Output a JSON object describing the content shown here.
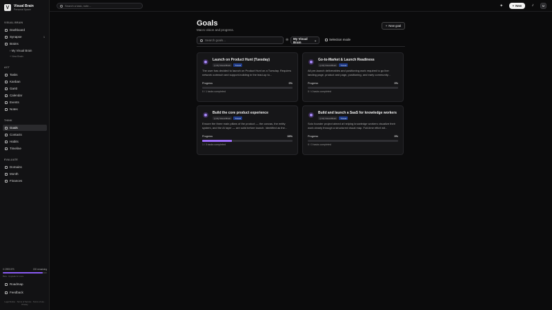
{
  "app": {
    "name": "Visual Brain",
    "subtitle": "Personal Space",
    "logo_letter": "V"
  },
  "topbar": {
    "search_placeholder": "Search a task, note...",
    "new_label": "New",
    "avatar_initial": "M"
  },
  "sidebar": {
    "sections": {
      "visual_brain": "VISUAL BRAIN",
      "act": "ACT",
      "think": "THINK",
      "evaluate": "EVALUATE"
    },
    "visual_brain_items": [
      {
        "label": "Dashboard",
        "icon": "grid-icon"
      },
      {
        "label": "Synapse",
        "icon": "spark-icon",
        "badge": "1"
      },
      {
        "label": "Brains",
        "icon": "brain-icon"
      }
    ],
    "brains_sub": {
      "item": "My Visual Brain",
      "add": "+ New Brain"
    },
    "act_items": [
      {
        "label": "Tasks",
        "icon": "check-icon"
      },
      {
        "label": "Kanban",
        "icon": "columns-icon"
      },
      {
        "label": "Gantt",
        "icon": "gantt-icon"
      },
      {
        "label": "Calendar",
        "icon": "calendar-icon"
      },
      {
        "label": "Events",
        "icon": "event-icon"
      },
      {
        "label": "Notes",
        "icon": "note-icon"
      }
    ],
    "think_items": [
      {
        "label": "Goals",
        "icon": "target-icon",
        "active": true
      },
      {
        "label": "Contacts",
        "icon": "users-icon"
      },
      {
        "label": "Habits",
        "icon": "pulse-icon"
      },
      {
        "label": "Timeline",
        "icon": "timeline-icon"
      }
    ],
    "evaluate_items": [
      {
        "label": "Domains",
        "icon": "domain-icon"
      },
      {
        "label": "Month",
        "icon": "month-icon"
      },
      {
        "label": "Finances",
        "icon": "wallet-icon"
      }
    ],
    "credits": {
      "left": "0 CREDITS",
      "right": "220 remaining",
      "note": "Beta · Upgrade for more",
      "fraction": 0.9
    },
    "bottom_items": [
      {
        "label": "Roadmap",
        "icon": "map-icon"
      },
      {
        "label": "Feedback",
        "icon": "message-icon"
      }
    ],
    "footer": "Legal Notice · Terms of Service · Terms of use · Privacy"
  },
  "main": {
    "title": "Goals",
    "subtitle": "Macro vision and progress.",
    "new_goal_label": "New goal",
    "search_placeholder": "Search goals...",
    "brain_select": "My Visual Brain",
    "selection_mode": "Selection mode",
    "progress_label": "Progress"
  },
  "goals": [
    {
      "title": "Launch on Product Hunt (Tuesday)",
      "owner": "My Visual Brain",
      "tag": "Travail",
      "desc": "The user has decided to launch on Product Hunt on a Tuesday. Requires network outreach and support-building in the lead-up to...",
      "progress": "0%",
      "progress_value": 0,
      "done": "0 / 1 tasks completed"
    },
    {
      "title": "Go-to-Market & Launch Readiness",
      "owner": "My Visual Brain",
      "tag": "Travail",
      "desc": "All pre-launch deliverables and positioning work required to go live: landing page, product and page, positioning, and early community...",
      "progress": "0%",
      "progress_value": 0,
      "done": "0 / 4 tasks completed"
    },
    {
      "title": "Build the core product experience",
      "owner": "My Visual Brain",
      "tag": "Travail",
      "desc": "Ensure the three main pillars of the product — the canvas, the entity system, and the AI layer — are solid before launch. Identified as the...",
      "progress": "33%",
      "progress_value": 0.33,
      "done": "1 / 3 tasks completed"
    },
    {
      "title": "Build and launch a SaaS for knowledge workers",
      "owner": "My Visual Brain",
      "tag": "Travail",
      "desc": "Solo founder project aimed at helping knowledge workers visualize their work clearly through a structured visual map. Full-time effort wit...",
      "progress": "0%",
      "progress_value": 0,
      "done": "0 / 3 tasks completed"
    }
  ]
}
